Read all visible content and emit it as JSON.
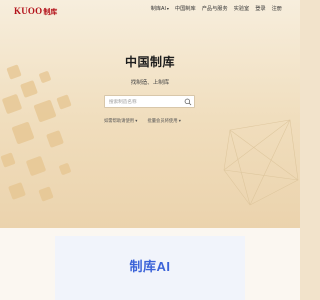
{
  "header": {
    "logo_en": "KUOO",
    "logo_cn": "制库",
    "nav": [
      {
        "label": "制库AI",
        "has_dropdown": true
      },
      {
        "label": "中国制库",
        "has_dropdown": false
      },
      {
        "label": "产品与服务",
        "has_dropdown": false
      },
      {
        "label": "实验室",
        "has_dropdown": false
      },
      {
        "label": "登录",
        "has_dropdown": false
      },
      {
        "label": "注册",
        "has_dropdown": false
      }
    ]
  },
  "hero": {
    "title": "中国制库",
    "subtitle": "找制造、上制库",
    "search_placeholder": "搜索制造名称",
    "links": [
      "如需帮助请使用 ▾",
      "批量会员将使用 ▾"
    ]
  },
  "section": {
    "title": "制库AI"
  },
  "colors": {
    "brand_red": "#b3121a",
    "ai_blue": "#3b63d8"
  }
}
